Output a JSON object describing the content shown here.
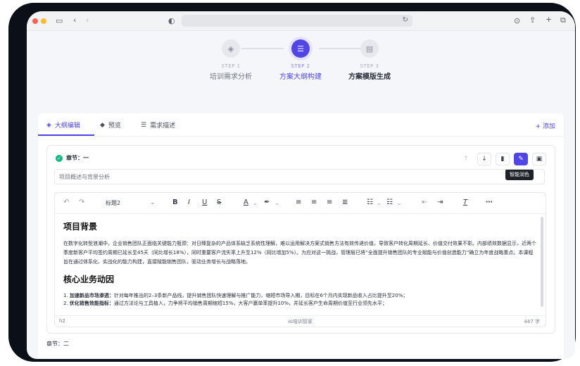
{
  "stepper": {
    "steps": [
      {
        "num": "STEP 1",
        "label": "培训需求分析"
      },
      {
        "num": "STEP 2",
        "label": "方案大纲构建"
      },
      {
        "num": "STEP 3",
        "label": "方案模版生成"
      }
    ]
  },
  "tabs": [
    {
      "label": "大纲编辑"
    },
    {
      "label": "预览"
    },
    {
      "label": "需求描述"
    }
  ],
  "add_label": "+ 添加",
  "chapter": {
    "title": "章节：一",
    "input_value": "项目概述与背景分析",
    "tooltip": "智能润色"
  },
  "editor": {
    "heading_select": "标题2",
    "h1": "项目背景",
    "p1": "在数字化转型浪潮中，企业销售团队正面临关键能力瓶颈：对日臻复杂的产品体系缺乏系统性理解，难以运用解决方案式销售方法有效传递价值，导致客户转化周期延长、价值交付效果不彰。内部绩效数据显示，近两个季度新客户平均签约周期已延长至45天（同比增长18%），同时重要客户流失率上升至12%（同比增加5%）。为应对这一挑战，管理层已将“全面提升销售团队的专业赋能与价值创造能力”确立为年度战略重点。本课程旨在通过体系化、实战化的能力构建，直接赋能销售团队，驱动业务增长与战略落地。",
    "h2": "核心业务动因",
    "list": [
      {
        "num": "1.",
        "bold": "加速新品市场渗透：",
        "text": "针对每年推出的2–3条新产品线，提升销售团队快速理解与推广能力，缩短市场导入期，目标在6个月内实现新品收入占比提升至20%；"
      },
      {
        "num": "2.",
        "bold": "优化销售效能指标：",
        "text": "通过方法论与工具植入，力争将平均销售周期缩短15%，大客户赢单率提升10%，并延长客户生命周期价值至行业领先水平；"
      }
    ],
    "status_left": "h2",
    "status_center": "AI培训管家",
    "status_right": "447 字"
  },
  "next_chapter": "章节：二",
  "colors": {
    "accent": "#4f46e5",
    "success": "#10b981",
    "frame": "#0b0f17"
  },
  "icons": {
    "toolbar": [
      "undo-icon",
      "redo-icon",
      "bold-icon",
      "italic-icon",
      "underline-icon",
      "strikethrough-icon",
      "font-color-icon",
      "highlight-icon",
      "align-left-icon",
      "align-center-icon",
      "align-right-icon",
      "align-justify-icon",
      "bullet-list-icon",
      "ordered-list-icon",
      "outdent-icon",
      "indent-icon",
      "clear-format-icon",
      "more-icon"
    ],
    "chapter_actions": [
      "arrow-up-icon",
      "arrow-down-icon",
      "trash-icon",
      "magic-wand-icon",
      "save-icon"
    ]
  }
}
